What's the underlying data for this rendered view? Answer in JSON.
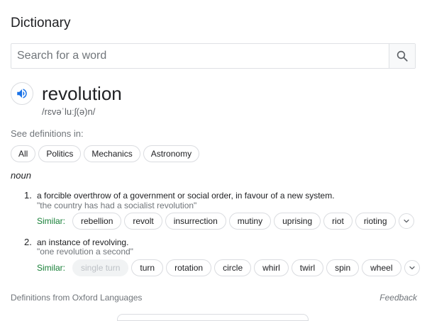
{
  "header": {
    "title": "Dictionary"
  },
  "search": {
    "placeholder": "Search for a word",
    "value": ""
  },
  "entry": {
    "word": "revolution",
    "phonetic": "/rɛvəˈluːʃ(ə)n/",
    "see_definitions_label": "See definitions in:",
    "categories": [
      "All",
      "Politics",
      "Mechanics",
      "Astronomy"
    ],
    "part_of_speech": "noun",
    "senses": [
      {
        "number": "1.",
        "definition": "a forcible overthrow of a government or social order, in favour of a new system.",
        "example": "\"the country has had a socialist revolution\"",
        "similar_label": "Similar:",
        "synonyms": [
          {
            "text": "rebellion",
            "disabled": false
          },
          {
            "text": "revolt",
            "disabled": false
          },
          {
            "text": "insurrection",
            "disabled": false
          },
          {
            "text": "mutiny",
            "disabled": false
          },
          {
            "text": "uprising",
            "disabled": false
          },
          {
            "text": "riot",
            "disabled": false
          },
          {
            "text": "rioting",
            "disabled": false
          }
        ]
      },
      {
        "number": "2.",
        "definition": "an instance of revolving.",
        "example": "\"one revolution a second\"",
        "similar_label": "Similar:",
        "synonyms": [
          {
            "text": "single turn",
            "disabled": true
          },
          {
            "text": "turn",
            "disabled": false
          },
          {
            "text": "rotation",
            "disabled": false
          },
          {
            "text": "circle",
            "disabled": false
          },
          {
            "text": "whirl",
            "disabled": false
          },
          {
            "text": "twirl",
            "disabled": false
          },
          {
            "text": "spin",
            "disabled": false
          },
          {
            "text": "wheel",
            "disabled": false
          }
        ]
      }
    ]
  },
  "footer": {
    "source": "Definitions from Oxford Languages",
    "feedback": "Feedback"
  },
  "icons": {
    "search": "search-icon",
    "speaker": "speaker-icon",
    "expand": "chevron-down-icon"
  },
  "colors": {
    "similar_label": "#188038",
    "speaker_accent": "#1a73e8",
    "muted_text": "#70757a"
  }
}
